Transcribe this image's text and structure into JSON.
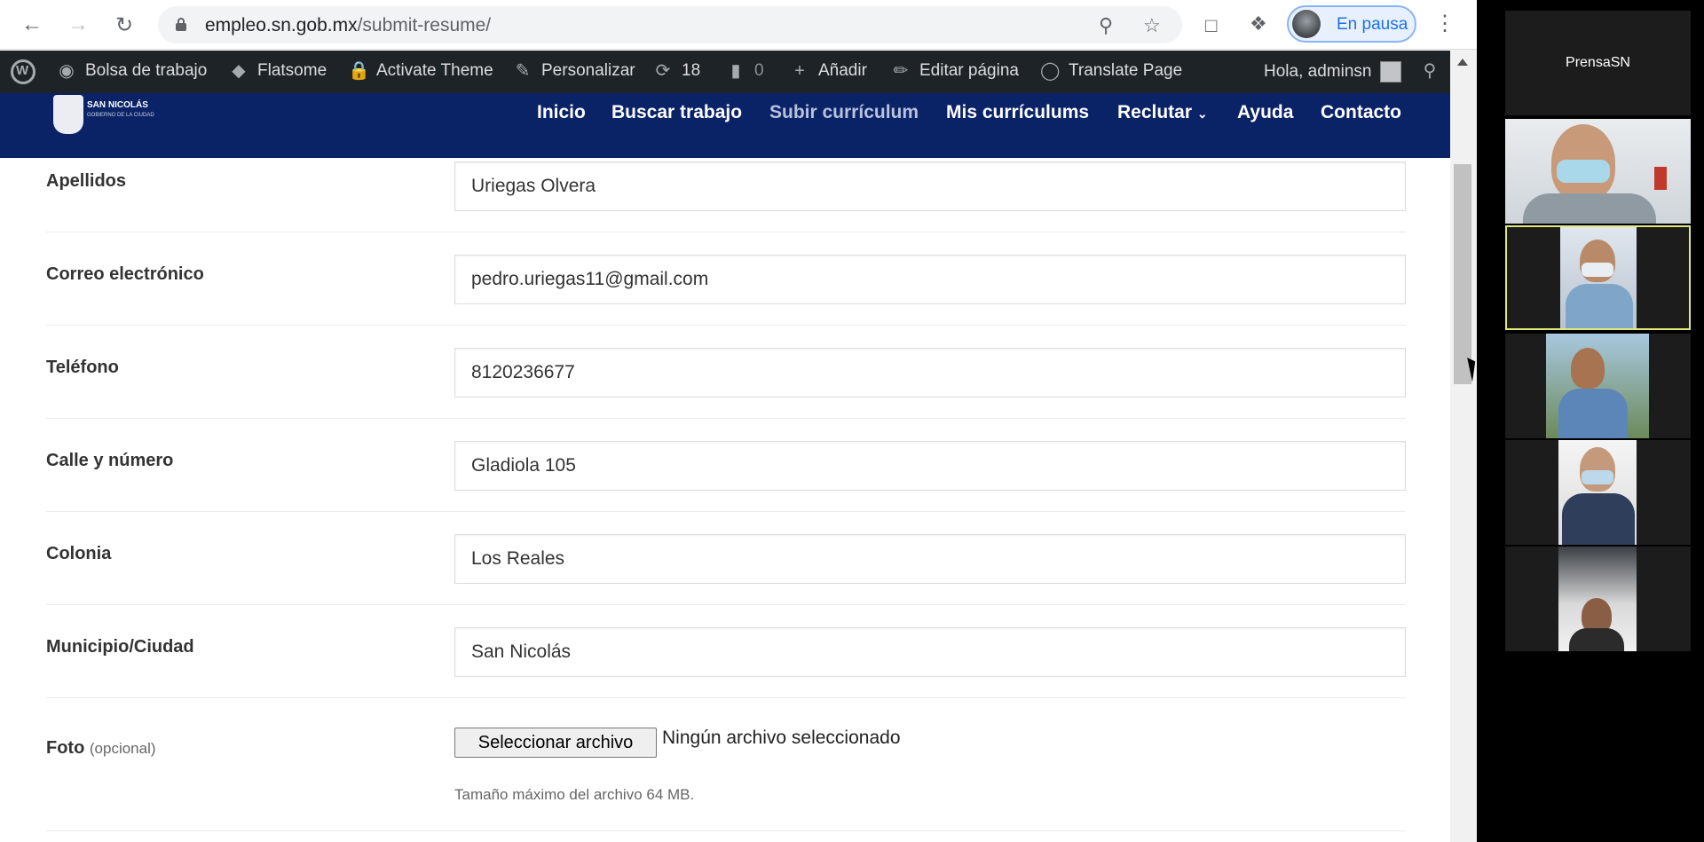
{
  "browser": {
    "nav": {
      "back_icon": "arrow-left-icon",
      "forward_icon": "arrow-right-icon",
      "reload_icon": "reload-icon"
    },
    "url_host": "empleo.sn.gob.mx",
    "url_path": "/submit-resume/",
    "profile_status": "En pausa"
  },
  "wp_admin_bar": {
    "site_name": "Bolsa de trabajo",
    "theme": "Flatsome",
    "activate": "Activate Theme",
    "customize": "Personalizar",
    "updates_count": "18",
    "comments_count": "0",
    "add_new": "Añadir",
    "edit_page": "Editar página",
    "translate": "Translate Page",
    "greeting": "Hola, adminsn"
  },
  "site_nav": {
    "logo_text": "SAN NICOLÁS",
    "logo_subtext": "GOBIERNO DE LA CIUDAD",
    "items": [
      "Inicio",
      "Buscar trabajo",
      "Subir currículum",
      "Mis currículums",
      "Reclutar",
      "Ayuda",
      "Contacto"
    ],
    "active_item": "Subir currículum"
  },
  "form": {
    "fields": [
      {
        "label": "Apellidos",
        "value": "Uriegas Olvera"
      },
      {
        "label": "Correo electrónico",
        "value": "pedro.uriegas11@gmail.com"
      },
      {
        "label": "Teléfono",
        "value": "8120236677"
      },
      {
        "label": "Calle y número",
        "value": "Gladiola 105"
      },
      {
        "label": "Colonia",
        "value": "Los Reales"
      },
      {
        "label": "Municipio/Ciudad",
        "value": "San Nicolás"
      }
    ],
    "photo": {
      "label": "Foto",
      "optional": "(opcional)",
      "button": "Seleccionar archivo",
      "status": "Ningún archivo seleccionado",
      "note": "Tamaño máximo del archivo 64 MB."
    }
  },
  "video_call": {
    "presenter_name": "PrensaSN",
    "participant_count": 5
  },
  "colors": {
    "wp_bar": "#1d2327",
    "site_nav": "#0a2266",
    "active_speaker_border": "#e2e87a",
    "profile_accent": "#1a73e8"
  }
}
